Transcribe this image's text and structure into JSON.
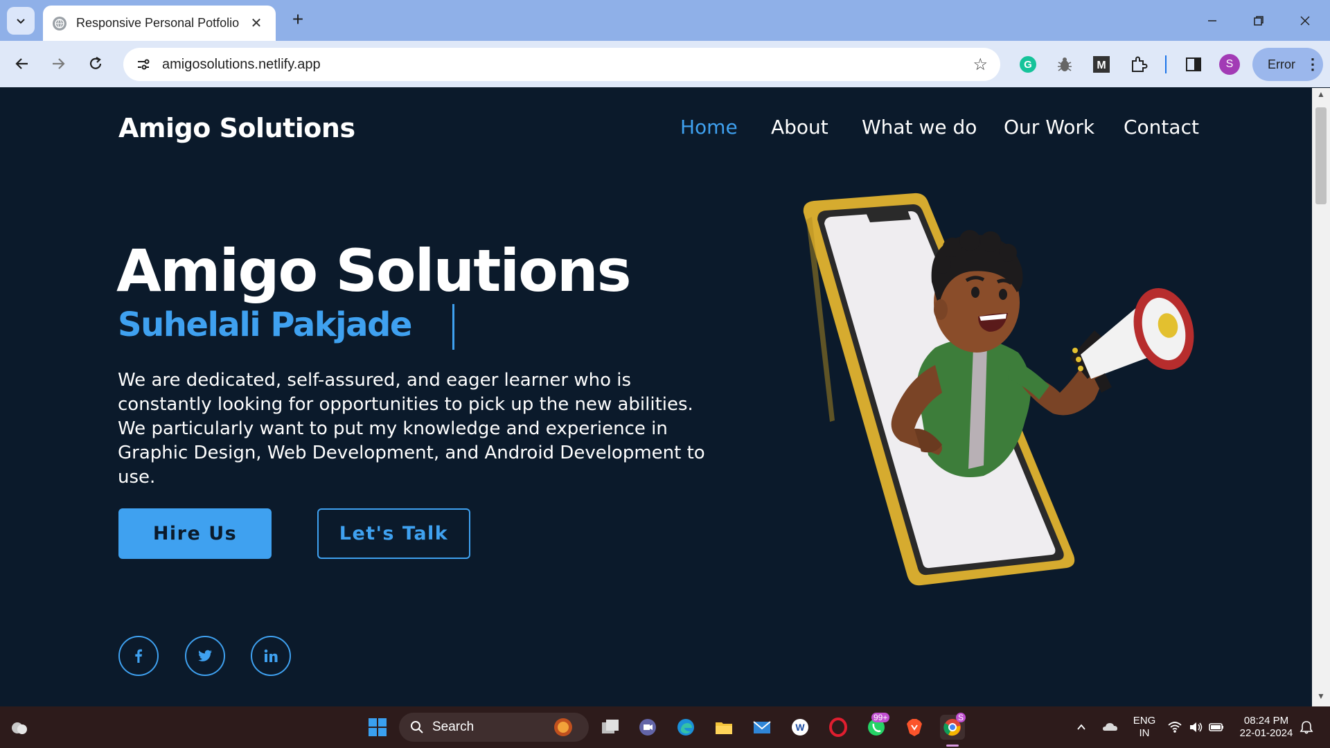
{
  "browser": {
    "tab_title": "Responsive Personal Potfolio",
    "url": "amigosolutions.netlify.app",
    "error_label": "Error",
    "profile_initial": "S"
  },
  "site": {
    "brand": "Amigo Solutions",
    "nav": [
      "Home",
      "About",
      "What we do",
      "Our Work",
      "Contact"
    ],
    "hero_title": "Amigo Solutions",
    "hero_subtitle": "Suhelali Pakjade",
    "hero_description": "We are dedicated, self-assured, and eager learner who is constantly looking for opportunities to pick up the new abilities. We particularly want to put my knowledge and experience in Graphic Design, Web Development, and Android Development to use.",
    "primary_button": "Hire Us",
    "secondary_button": "Let's Talk",
    "social": [
      "facebook-icon",
      "twitter-icon",
      "linkedin-icon"
    ],
    "accent_color": "#3fa1f0",
    "background_color": "#0b1a2b"
  },
  "taskbar": {
    "search_label": "Search",
    "whatsapp_badge": "99+",
    "chrome_badge": "S",
    "lang_line1": "ENG",
    "lang_line2": "IN",
    "time": "08:24 PM",
    "date": "22-01-2024"
  }
}
